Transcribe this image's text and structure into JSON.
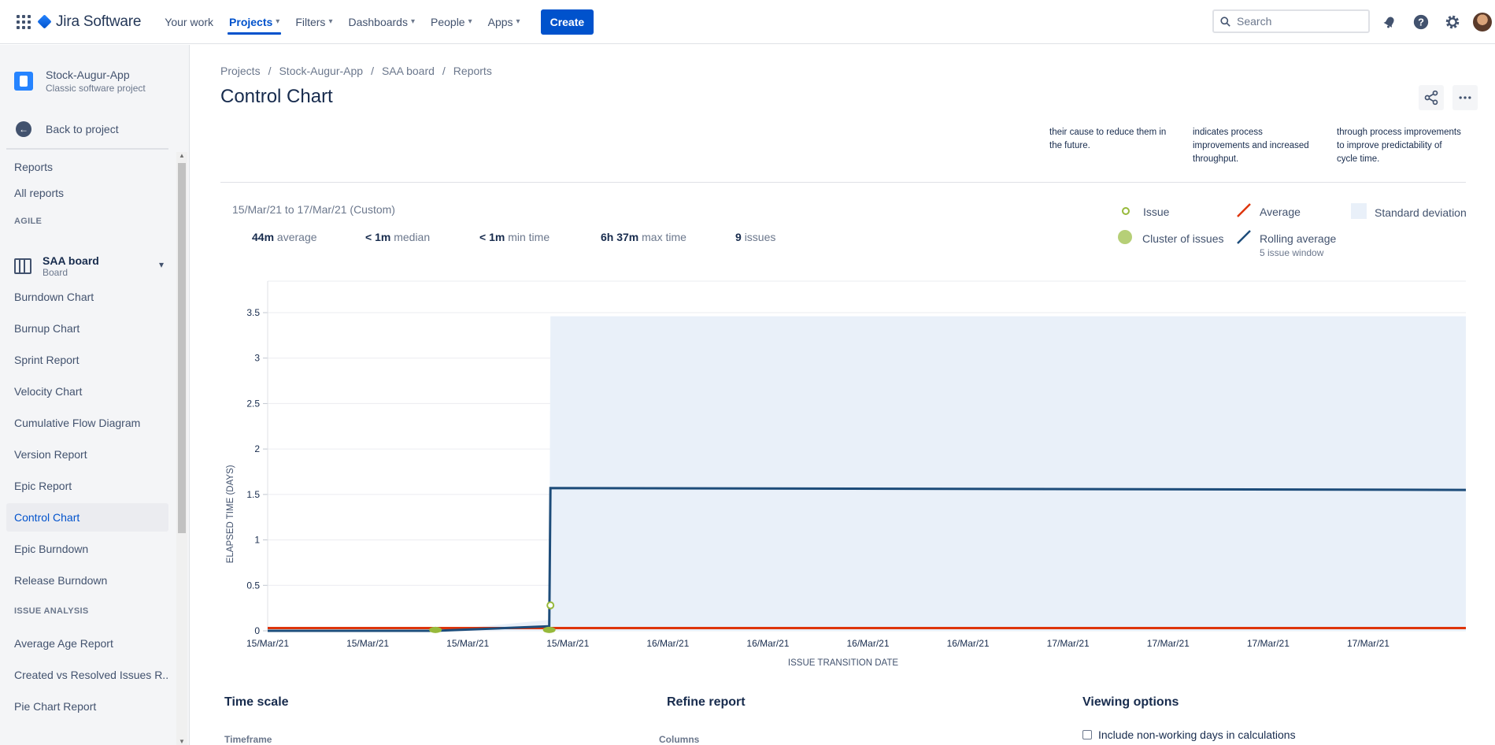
{
  "topnav": {
    "logo_text": "Jira Software",
    "items": [
      {
        "label": "Your work",
        "has_chevron": false
      },
      {
        "label": "Projects",
        "has_chevron": true,
        "active": true
      },
      {
        "label": "Filters",
        "has_chevron": true
      },
      {
        "label": "Dashboards",
        "has_chevron": true
      },
      {
        "label": "People",
        "has_chevron": true
      },
      {
        "label": "Apps",
        "has_chevron": true
      }
    ],
    "create_label": "Create",
    "search_placeholder": "Search",
    "accent_color": "#0052cc"
  },
  "sidebar": {
    "project_name": "Stock-Augur-App",
    "project_type": "Classic software project",
    "back_label": "Back to project",
    "reports_heading": "Reports",
    "all_reports": "All reports",
    "agile_heading": "AGILE",
    "board_name": "SAA board",
    "board_sub": "Board",
    "agile_items": [
      "Burndown Chart",
      "Burnup Chart",
      "Sprint Report",
      "Velocity Chart",
      "Cumulative Flow Diagram",
      "Version Report",
      "Epic Report",
      "Control Chart",
      "Epic Burndown",
      "Release Burndown"
    ],
    "selected_item": "Control Chart",
    "issue_analysis_heading": "ISSUE ANALYSIS",
    "issue_items": [
      "Average Age Report",
      "Created vs Resolved Issues R...",
      "Pie Chart Report"
    ]
  },
  "breadcrumb": [
    "Projects",
    "Stock-Augur-App",
    "SAA board",
    "Reports"
  ],
  "page_title": "Control Chart",
  "hints": [
    "their cause to reduce them in the future.",
    "indicates process improvements and increased throughput.",
    "through process improvements to improve predictability of cycle time."
  ],
  "summary": {
    "range": "15/Mar/21 to 17/Mar/21 (Custom)",
    "stats": [
      {
        "value": "44m",
        "label": "average"
      },
      {
        "value": "< 1m",
        "label": "median"
      },
      {
        "value": "< 1m",
        "label": "min time"
      },
      {
        "value": "6h 37m",
        "label": "max time"
      },
      {
        "value": "9",
        "label": "issues"
      }
    ]
  },
  "legend": {
    "issue": "Issue",
    "cluster": "Cluster of issues",
    "average": "Average",
    "rolling": "Rolling average",
    "rolling_sub": "5 issue window",
    "stddev": "Standard deviation"
  },
  "chart_data": {
    "type": "line",
    "ylabel": "ELAPSED TIME (DAYS)",
    "xlabel": "ISSUE TRANSITION DATE",
    "ylim": [
      0,
      3.5
    ],
    "yticks": [
      0,
      0.5,
      1,
      1.5,
      2,
      2.5,
      3,
      3.5
    ],
    "x_tick_labels": [
      "15/Mar/21",
      "15/Mar/21",
      "15/Mar/21",
      "15/Mar/21",
      "16/Mar/21",
      "16/Mar/21",
      "16/Mar/21",
      "16/Mar/21",
      "17/Mar/21",
      "17/Mar/21",
      "17/Mar/21",
      "17/Mar/21"
    ],
    "x_range_fraction": [
      0,
      1
    ],
    "grid": true,
    "colors": {
      "average": "#de350b",
      "rolling": "#1d4c7a",
      "stddev": "#e9f0f9",
      "issue": "#97b93b"
    },
    "average_line": 0.03,
    "rolling_average": [
      {
        "x": 0.0,
        "y": 0.0
      },
      {
        "x": 0.14,
        "y": 0.0
      },
      {
        "x": 0.235,
        "y": 0.05
      },
      {
        "x": 0.236,
        "y": 1.57
      },
      {
        "x": 1.0,
        "y": 1.55
      }
    ],
    "stddev_band": [
      {
        "x": 0.14,
        "y0": 0.0,
        "y1": 0.0
      },
      {
        "x": 0.235,
        "y0": 0.0,
        "y1": 0.12
      },
      {
        "x": 0.236,
        "y0": 0.0,
        "y1": 3.46
      },
      {
        "x": 1.0,
        "y0": 0.0,
        "y1": 3.46
      }
    ],
    "issues": [
      {
        "x": 0.236,
        "y": 0.28
      }
    ],
    "clusters": [
      {
        "x": 0.14,
        "y": 0.01
      },
      {
        "x": 0.235,
        "y": 0.01
      }
    ]
  },
  "sections": {
    "time_scale": "Time scale",
    "timeframe": "Timeframe",
    "refine": "Refine report",
    "columns": "Columns",
    "viewing": "Viewing options",
    "non_working": "Include non-working days in calculations"
  }
}
